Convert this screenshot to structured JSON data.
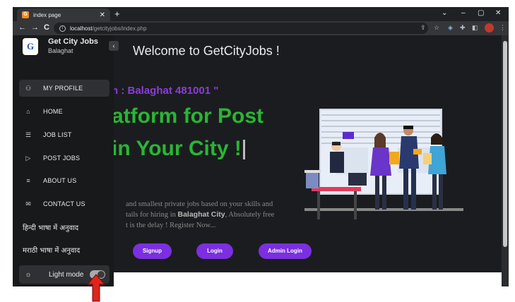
{
  "browser": {
    "tab_title": "index page",
    "tab_close": "✕",
    "new_tab": "+",
    "window_controls": [
      "⌄",
      "–",
      "▢",
      "✕"
    ],
    "url_host": "localhost",
    "url_path": "/getcityjobs/index.php",
    "nav": {
      "back": "←",
      "forward": "→",
      "reload": "C"
    },
    "info_glyph": "i"
  },
  "sidebar": {
    "logo_letter": "G",
    "brand_title": "Get City Jobs",
    "brand_city": "Balaghat",
    "collapse_glyph": "‹",
    "items": [
      {
        "icon": "user-icon",
        "glyph": "⚇",
        "label": "MY PROFILE",
        "active": true
      },
      {
        "icon": "home-icon",
        "glyph": "⌂",
        "label": "HOME",
        "active": false
      },
      {
        "icon": "list-icon",
        "glyph": "☰",
        "label": "JOB LIST",
        "active": false
      },
      {
        "icon": "send-icon",
        "glyph": "▷",
        "label": "POST JOBS",
        "active": false
      },
      {
        "icon": "about-icon",
        "glyph": "≡",
        "label": "ABOUT US",
        "active": false
      },
      {
        "icon": "contact-icon",
        "glyph": "✉",
        "label": "CONTACT US",
        "active": false
      }
    ],
    "lang_hindi": "हिन्दी भाषा में अनुवाद",
    "lang_marathi": "मराठी भाषा में अनुवाद",
    "mode_label": "Light mode",
    "mode_glyph": "☼"
  },
  "main": {
    "welcome": "Welcome to GetCityJobs !",
    "city_line": "n : Balaghat 481001 \"",
    "headline_1": "atform for Post",
    "headline_2": "in Your City !",
    "desc_1": "and smallest private jobs based on your skills and",
    "desc_2_a": "tails for hiring in ",
    "desc_2_city": "Balaghat City",
    "desc_2_b": ", Absolutely free",
    "desc_3": "t is the delay ! Register Now...",
    "buttons": {
      "signup": "Signup",
      "login": "Login",
      "admin": "Admin Login"
    }
  },
  "colors": {
    "accent_purple": "#7b2fe0",
    "headline_green": "#29b633",
    "annotation_arrow": "#e0241c"
  }
}
